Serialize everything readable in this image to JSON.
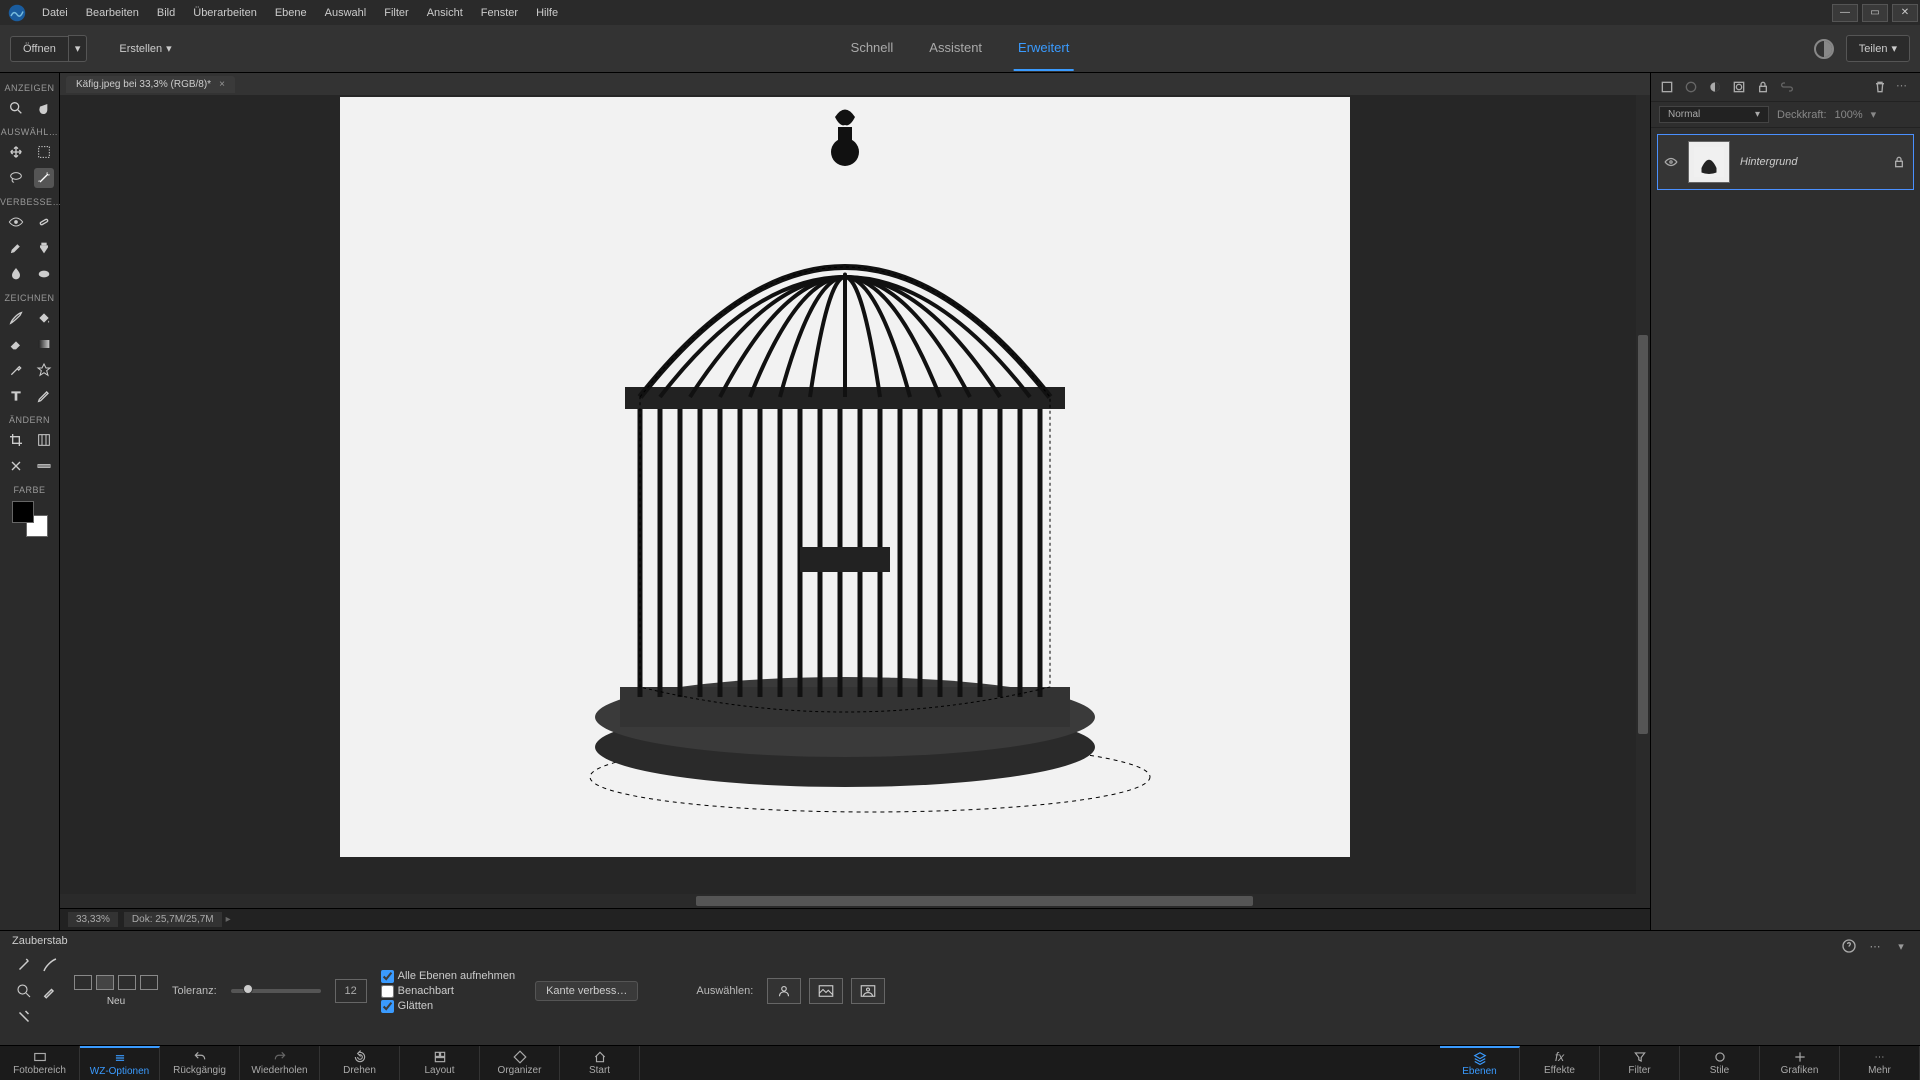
{
  "menu": [
    "Datei",
    "Bearbeiten",
    "Bild",
    "Überarbeiten",
    "Ebene",
    "Auswahl",
    "Filter",
    "Ansicht",
    "Fenster",
    "Hilfe"
  ],
  "topbar": {
    "open": "Öffnen",
    "create": "Erstellen",
    "tabs": {
      "quick": "Schnell",
      "guided": "Assistent",
      "expert": "Erweitert"
    },
    "share": "Teilen"
  },
  "doc_tab": {
    "label": "Käfig.jpeg bei 33,3% (RGB/8)*"
  },
  "left_sections": {
    "view": "ANZEIGEN",
    "select": "AUSWÄHL…",
    "enhance": "VERBESSE…",
    "draw": "ZEICHNEN",
    "modify": "ÄNDERN",
    "color": "FARBE"
  },
  "layers": {
    "blend_mode": "Normal",
    "opacity_label": "Deckkraft:",
    "opacity_value": "100%",
    "layer_name": "Hintergrund"
  },
  "status": {
    "zoom": "33,33%",
    "dok": "Dok:  25,7M/25,7M"
  },
  "options": {
    "tool_name": "Zauberstab",
    "neu": "Neu",
    "tolerance_label": "Toleranz:",
    "tolerance_value": "12",
    "cb_all_layers": "Alle Ebenen aufnehmen",
    "cb_contiguous": "Benachbart",
    "cb_antialias": "Glätten",
    "refine": "Kante verbess…",
    "select_label": "Auswählen:"
  },
  "bottomnav": {
    "left": [
      "Fotobereich",
      "WZ-Optionen",
      "Rückgängig",
      "Wiederholen",
      "Drehen",
      "Layout",
      "Organizer",
      "Start"
    ],
    "right": [
      "Ebenen",
      "Effekte",
      "Filter",
      "Stile",
      "Grafiken",
      "Mehr"
    ]
  }
}
